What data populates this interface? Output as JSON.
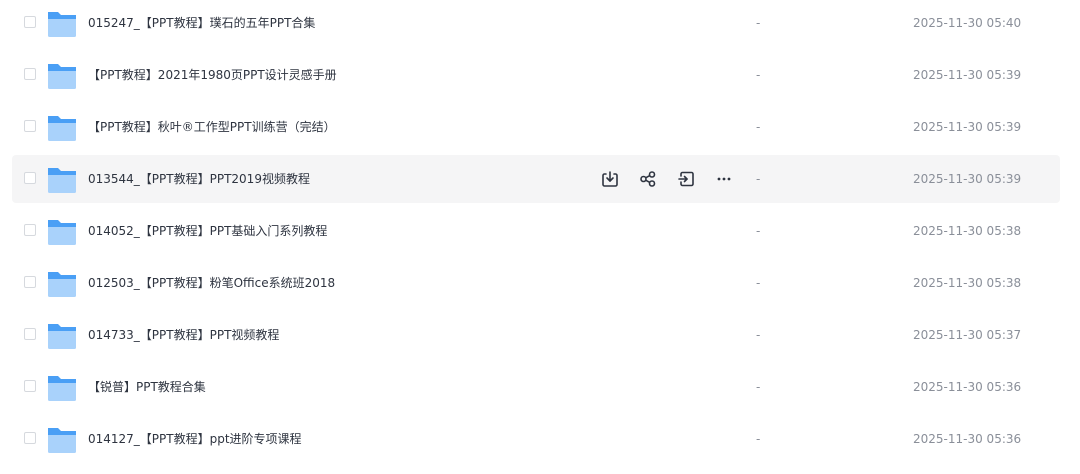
{
  "files": [
    {
      "name": "015247_【PPT教程】璞石的五年PPT合集",
      "size": "-",
      "modified": "2025-11-30 05:40"
    },
    {
      "name": "【PPT教程】2021年1980页PPT设计灵感手册",
      "size": "-",
      "modified": "2025-11-30 05:39"
    },
    {
      "name": "【PPT教程】秋叶®工作型PPT训练营（完结）",
      "size": "-",
      "modified": "2025-11-30 05:39"
    },
    {
      "name": "013544_【PPT教程】PPT2019视频教程",
      "size": "-",
      "modified": "2025-11-30 05:39"
    },
    {
      "name": "014052_【PPT教程】PPT基础入门系列教程",
      "size": "-",
      "modified": "2025-11-30 05:38"
    },
    {
      "name": "012503_【PPT教程】粉笔Office系统班2018",
      "size": "-",
      "modified": "2025-11-30 05:38"
    },
    {
      "name": "014733_【PPT教程】PPT视频教程",
      "size": "-",
      "modified": "2025-11-30 05:37"
    },
    {
      "name": "【锐普】PPT教程合集",
      "size": "-",
      "modified": "2025-11-30 05:36"
    },
    {
      "name": "014127_【PPT教程】ppt进阶专项课程",
      "size": "-",
      "modified": "2025-11-30 05:36"
    }
  ],
  "hovered_row_actions": [
    "download-icon",
    "share-icon",
    "move-icon",
    "more-icon"
  ],
  "colors": {
    "folder_light": "#a9d2fb",
    "folder_dark": "#4a9ff5",
    "hover_bg": "#f5f5f6",
    "icon": "#2e3440"
  }
}
